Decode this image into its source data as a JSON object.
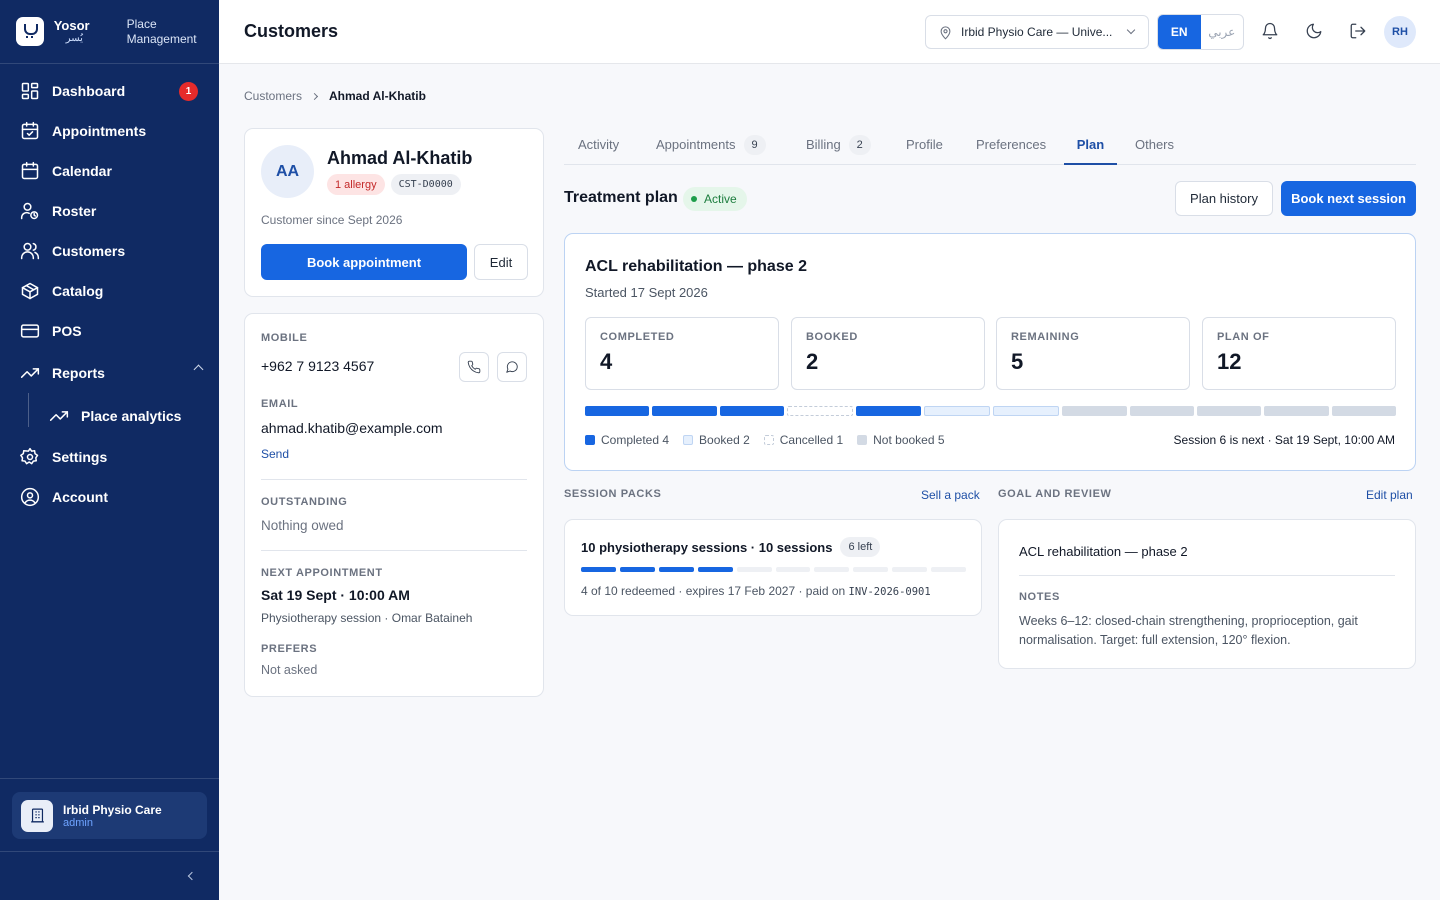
{
  "brand": {
    "name": "Yosor",
    "name_ar": "يُسر",
    "subtitle": "Place Management"
  },
  "nav": {
    "items": [
      {
        "label": "Dashboard",
        "badge": "1"
      },
      {
        "label": "Appointments"
      },
      {
        "label": "Calendar"
      },
      {
        "label": "Roster"
      },
      {
        "label": "Customers"
      },
      {
        "label": "Catalog"
      },
      {
        "label": "POS"
      },
      {
        "label": "Reports"
      },
      {
        "label": "Place analytics"
      },
      {
        "label": "Settings"
      },
      {
        "label": "Account"
      }
    ]
  },
  "place": {
    "name": "Irbid Physio Care",
    "role": "admin"
  },
  "header": {
    "title": "Customers",
    "location": "Irbid Physio Care — Unive...",
    "lang_en": "EN",
    "lang_ar": "عربي",
    "user_initials": "RH"
  },
  "breadcrumb": {
    "parent": "Customers",
    "current": "Ahmad Al-Khatib"
  },
  "customer": {
    "initials": "AA",
    "name": "Ahmad Al-Khatib",
    "allergy_chip": "1 allergy",
    "id_chip": "CST-D0000",
    "since": "Customer since Sept 2026",
    "book_label": "Book appointment",
    "edit_label": "Edit"
  },
  "contact": {
    "mobile_label": "MOBILE",
    "mobile": "+962 7 9123 4567",
    "email_label": "EMAIL",
    "email": "ahmad.khatib@example.com",
    "send_label": "Send",
    "outstanding_label": "OUTSTANDING",
    "outstanding": "Nothing owed",
    "next_label": "NEXT APPOINTMENT",
    "next_time": "Sat 19 Sept · 10:00 AM",
    "next_detail": "Physiotherapy session · Omar Bataineh",
    "prefers_label": "PREFERS",
    "prefers": "Not asked"
  },
  "tabs": [
    {
      "label": "Activity"
    },
    {
      "label": "Appointments",
      "count": "9"
    },
    {
      "label": "Billing",
      "count": "2"
    },
    {
      "label": "Profile"
    },
    {
      "label": "Preferences"
    },
    {
      "label": "Plan",
      "active": true
    },
    {
      "label": "Others"
    }
  ],
  "plan_section": {
    "title": "Treatment plan",
    "status": "Active",
    "history_label": "Plan history",
    "book_next_label": "Book next session"
  },
  "plan": {
    "name": "ACL rehabilitation — phase 2",
    "started": "Started 17 Sept 2026",
    "stats": [
      {
        "label": "COMPLETED",
        "value": "4"
      },
      {
        "label": "BOOKED",
        "value": "2"
      },
      {
        "label": "REMAINING",
        "value": "5"
      },
      {
        "label": "PLAN OF",
        "value": "12"
      }
    ],
    "sessions": [
      "completed",
      "completed",
      "completed",
      "cancelled",
      "completed",
      "booked",
      "booked",
      "not_booked",
      "not_booked",
      "not_booked",
      "not_booked",
      "not_booked"
    ],
    "legend": [
      {
        "label": "Completed 4",
        "color": "#1766e1"
      },
      {
        "label": "Booked 2",
        "color": "#e6f0fd"
      },
      {
        "label": "Cancelled 1",
        "color": "#ffffff"
      },
      {
        "label": "Not booked 5",
        "color": "#d3dae4"
      }
    ],
    "next": "Session 6 is next · Sat 19 Sept, 10:00 AM"
  },
  "packs": {
    "heading": "SESSION PACKS",
    "sell_label": "Sell a pack",
    "title": "10 physiotherapy sessions · 10 sessions",
    "left_badge": "6 left",
    "redeemed": 4,
    "total": 10,
    "meta": "4 of 10 redeemed · expires 17 Feb 2027 · paid on",
    "invoice": "INV-2026-0901"
  },
  "goal": {
    "heading": "GOAL AND REVIEW",
    "edit_label": "Edit plan",
    "title": "ACL rehabilitation — phase 2",
    "notes_label": "NOTES",
    "notes": "Weeks 6–12: closed-chain strengthening, proprioception, gait normalisation. Target: full extension, 120° flexion."
  }
}
